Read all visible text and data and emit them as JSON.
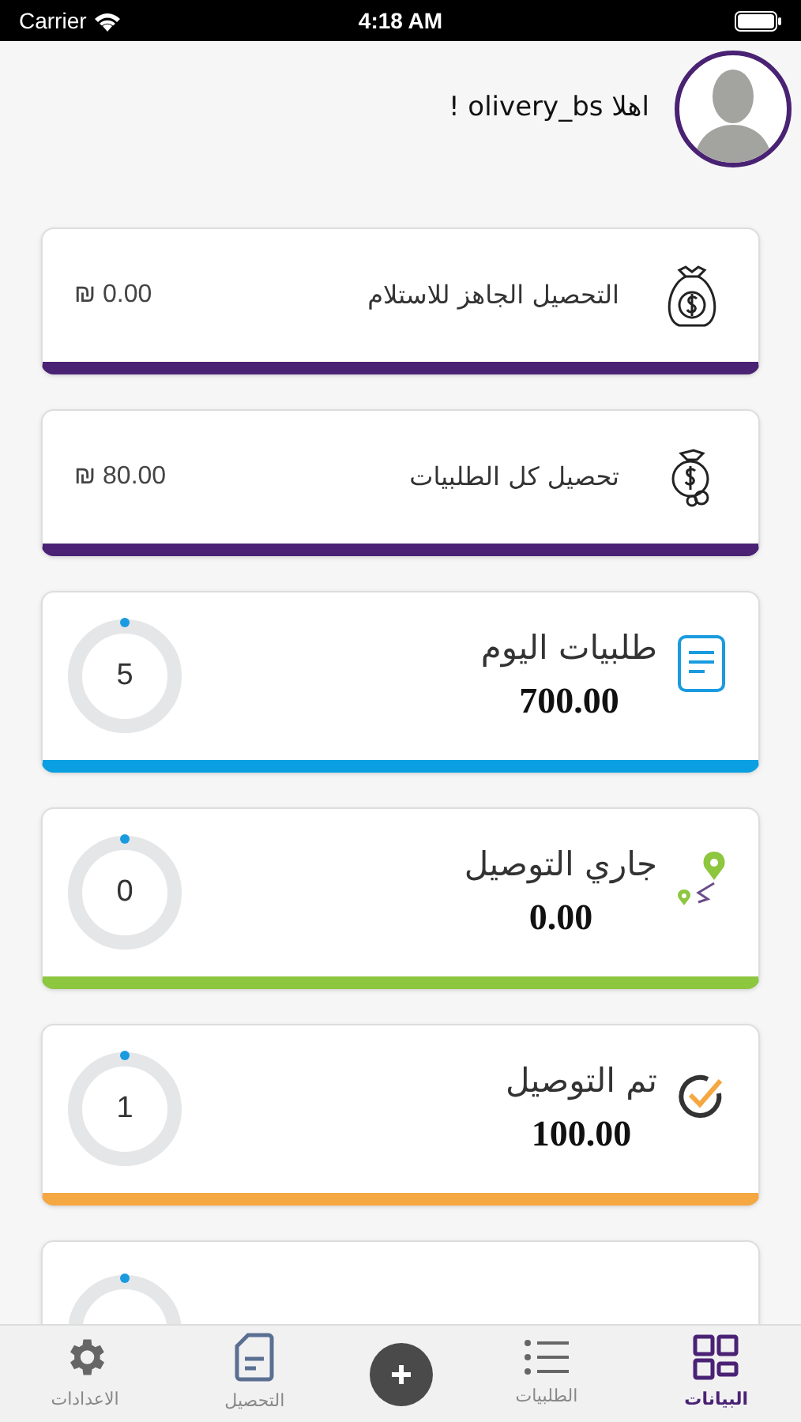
{
  "status_bar": {
    "carrier": "Carrier",
    "time": "4:18 AM"
  },
  "greeting": "اهلا olivery_bs !",
  "money_cards": [
    {
      "title": "التحصيل الجاهز للاستلام",
      "amount": "₪ 0.00",
      "kind": "bag"
    },
    {
      "title": "تحصيل كل الطلبيات",
      "amount": "₪ 80.00",
      "kind": "coins"
    }
  ],
  "stat_cards": [
    {
      "title": "طلبيات اليوم",
      "amount": "700.00",
      "count": "5",
      "kind": "document",
      "color": "#0a9fe0"
    },
    {
      "title": "جاري التوصيل",
      "amount": "0.00",
      "count": "0",
      "kind": "route",
      "color": "#8dc63f"
    },
    {
      "title": "تم التوصيل",
      "amount": "100.00",
      "count": "1",
      "kind": "check",
      "color": "#f5a742"
    }
  ],
  "tabs": [
    {
      "label": "البيانات",
      "kind": "grid",
      "selected": true
    },
    {
      "label": "الطلبيات",
      "kind": "list",
      "selected": false
    },
    {
      "kind": "add"
    },
    {
      "label": "التحصيل",
      "kind": "document",
      "selected": false
    },
    {
      "label": "الاعدادات",
      "kind": "gear",
      "selected": false
    }
  ]
}
